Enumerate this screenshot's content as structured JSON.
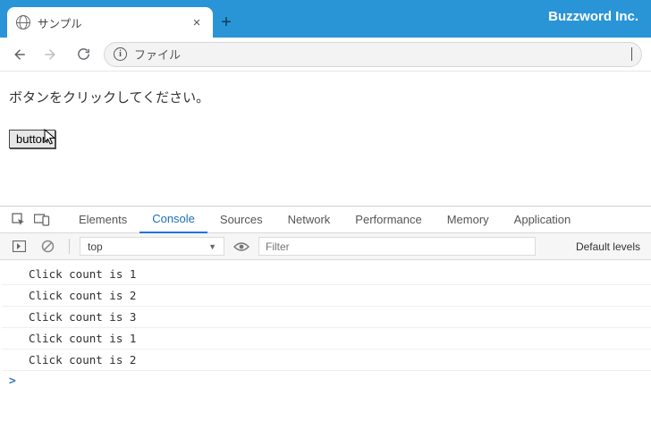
{
  "browser": {
    "brand": "Buzzword Inc.",
    "tab_title": "サンプル",
    "address_prefix": "ファイル",
    "nav": {
      "back_enabled": true,
      "forward_enabled": false
    }
  },
  "page": {
    "prompt_text": "ボタンをクリックしてください。",
    "button_label": "button"
  },
  "devtools": {
    "tabs": {
      "elements": "Elements",
      "console": "Console",
      "sources": "Sources",
      "network": "Network",
      "performance": "Performance",
      "memory": "Memory",
      "application": "Application"
    },
    "active_tab": "console",
    "context_label": "top",
    "filter_placeholder": "Filter",
    "level_label": "Default levels",
    "log": [
      "Click count is 1",
      "Click count is 2",
      "Click count is 3",
      "Click count is 1",
      "Click count is 2"
    ],
    "prompt_symbol": ">"
  }
}
